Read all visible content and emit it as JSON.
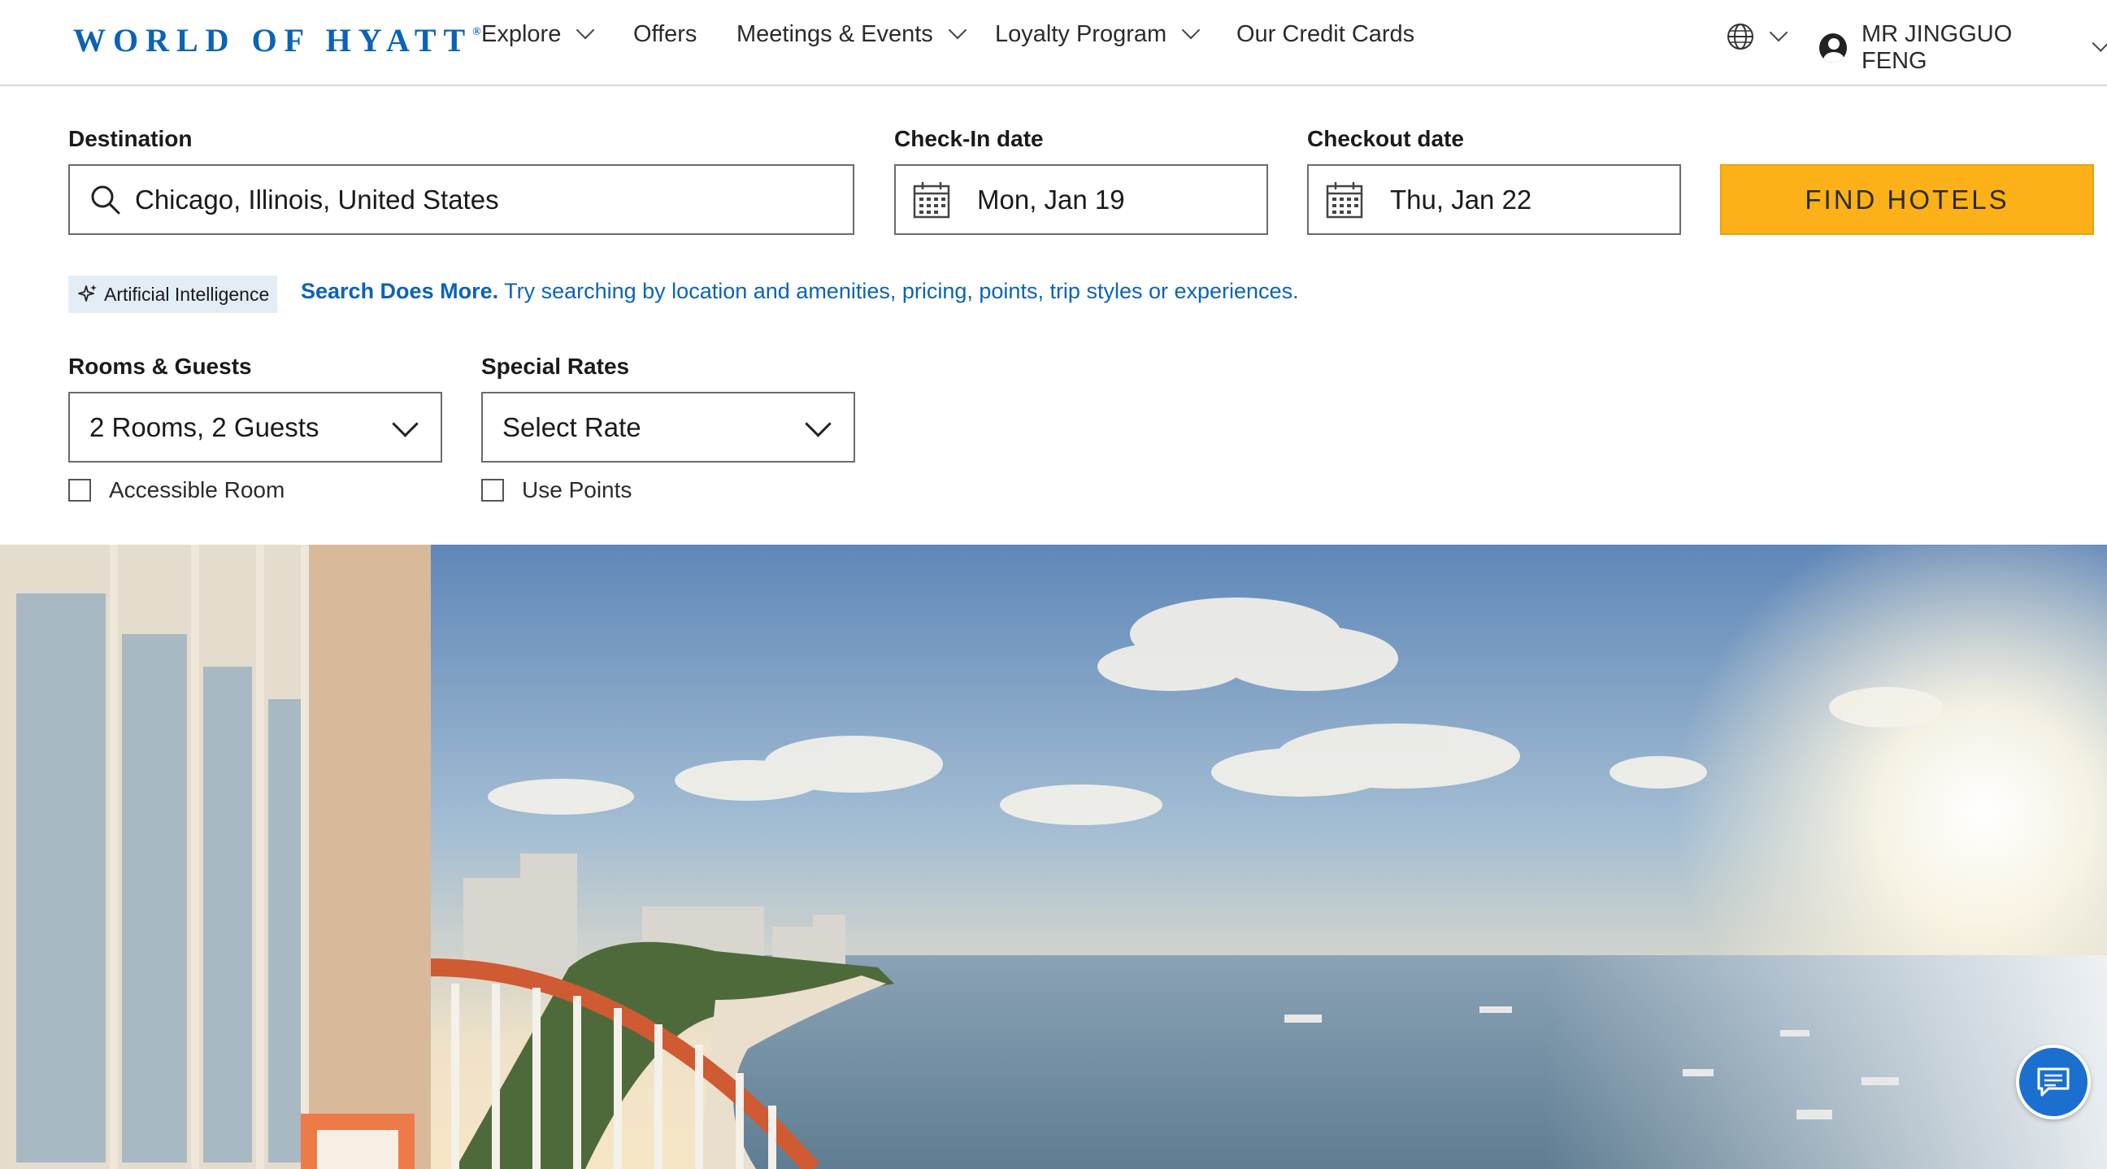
{
  "header": {
    "logo_text": "WORLD OF HYATT",
    "logo_mark": "®",
    "nav": [
      {
        "label": "Explore",
        "has_dropdown": true
      },
      {
        "label": "Offers",
        "has_dropdown": false
      },
      {
        "label": "Meetings & Events",
        "has_dropdown": true
      },
      {
        "label": "Loyalty Program",
        "has_dropdown": true
      },
      {
        "label": "Our Credit Cards",
        "has_dropdown": false
      }
    ],
    "language_icon": "globe-icon",
    "user_name": "MR JINGGUO FENG"
  },
  "search": {
    "destination_label": "Destination",
    "destination_value": "Chicago, Illinois, United States",
    "checkin_label": "Check-In date",
    "checkin_value": "Mon, Jan 19",
    "checkout_label": "Checkout date",
    "checkout_value": "Thu, Jan 22",
    "find_button": "FIND HOTELS",
    "ai_badge": "Artificial Intelligence",
    "ai_headline": "Search Does More.",
    "ai_hint": "Try searching by location and amenities, pricing, points, trip styles or experiences.",
    "rooms_label": "Rooms & Guests",
    "rooms_value": "2 Rooms, 2 Guests",
    "rates_label": "Special Rates",
    "rates_value": "Select Rate",
    "accessible_label": "Accessible Room",
    "points_label": "Use Points"
  },
  "colors": {
    "brand_blue": "#0b63b5",
    "find_button": "#fbb117",
    "ai_badge_bg": "#e3edf6",
    "chat_button": "#1a6fcf"
  },
  "hero": {
    "image": "oceanfront hotel balcony view"
  },
  "chat": {
    "icon": "chat-icon"
  }
}
